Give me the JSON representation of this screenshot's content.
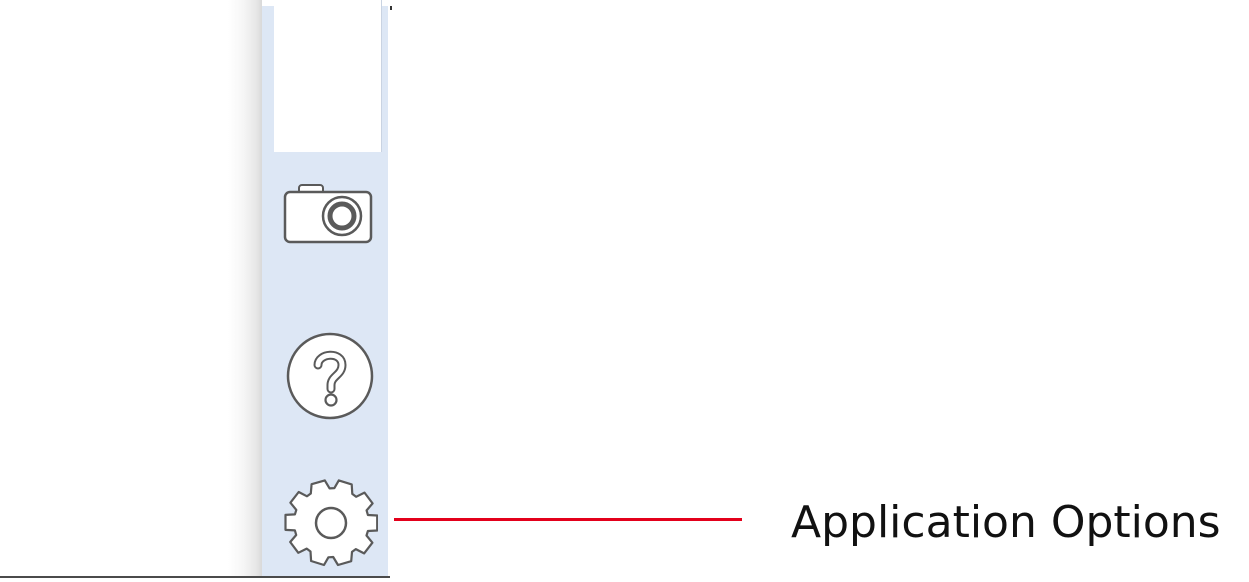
{
  "toolbar": {
    "buttons": [
      {
        "id": "camera",
        "icon": "camera-icon"
      },
      {
        "id": "help",
        "icon": "help-icon"
      },
      {
        "id": "options",
        "icon": "gear-icon"
      }
    ]
  },
  "callout": {
    "label": "Application Options",
    "line_color": "#e3001b"
  },
  "colors": {
    "toolbar_bg": "#dde7f5",
    "icon_stroke": "#5a5a5a"
  }
}
